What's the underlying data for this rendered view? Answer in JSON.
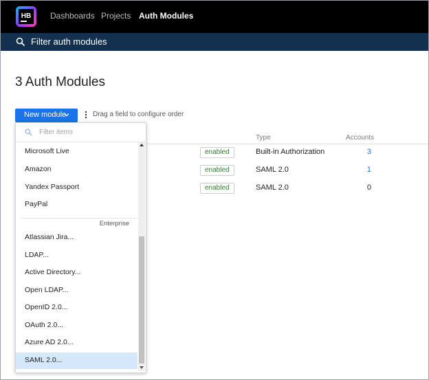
{
  "app": {
    "logo_text": "HB",
    "nav": [
      {
        "label": "Dashboards"
      },
      {
        "label": "Projects"
      },
      {
        "label": "Auth Modules",
        "active": true
      }
    ]
  },
  "filter_bar": {
    "label": "Filter auth modules",
    "icon": "search-icon"
  },
  "main": {
    "title": "3 Auth Modules",
    "new_module_label": "New module",
    "drag_hint": "Drag a field to configure order"
  },
  "table": {
    "columns": [
      "Type",
      "Accounts"
    ],
    "rows": [
      {
        "status": "enabled",
        "type": "Built-in Authorization",
        "accounts": "3",
        "accounts_link": true
      },
      {
        "status": "enabled",
        "type": "SAML 2.0",
        "accounts": "1",
        "accounts_link": true
      },
      {
        "status": "enabled",
        "type": "SAML 2.0",
        "accounts": "0",
        "accounts_link": false
      }
    ]
  },
  "dropdown": {
    "placeholder": "Filter items",
    "group_label": "Enterprise",
    "items": [
      "Microsoft Live",
      "Amazon",
      "Yandex Passport",
      "PayPal",
      "Atlassian Jira...",
      "LDAP...",
      "Active Directory...",
      "Open LDAP...",
      "OpenID 2.0...",
      "OAuth 2.0...",
      "Azure AD 2.0...",
      "SAML 2.0..."
    ],
    "selected_item": "SAML 2.0..."
  },
  "colors": {
    "topbar": "#000000",
    "filter_bar": "#13304f",
    "accent": "#1a73e8",
    "enabled_text": "#2e7d32",
    "selected_item": "#d4e8fa"
  }
}
